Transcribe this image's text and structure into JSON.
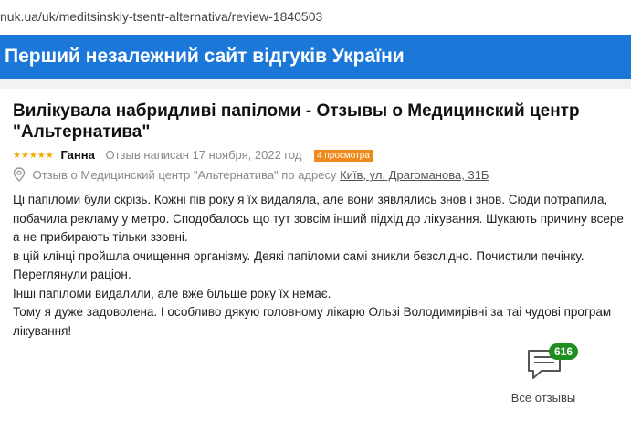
{
  "browser": {
    "url": "nuk.ua/uk/meditsinskiy-tsentr-alternativa/review-1840503"
  },
  "header": {
    "site_title": "Перший незалежний сайт відгуків України",
    "bg_color": "#1b78d8"
  },
  "review": {
    "title_line1": "Вилікувала набридливі папіломи - Отзывы о Медицинский центр",
    "title_line2": "\"Альтернатива\"",
    "stars": "★★★★★",
    "author": "Ганна",
    "date": "Отзыв написан 17 ноября, 2022 год",
    "views": "4 просмотра",
    "address_label": "Отзыв о Медицинский центр \"Альтернатива\" по адресу",
    "address_link": "Київ, ул. Драгоманова, 31Б",
    "body": [
      "Ці папіломи були скрізь. Кожні пів року я їх видаляла, але вони зявлялись знов і знов. Сюди потрапила,",
      "побачила рекламу у метро. Сподобалось що тут зовсім інший підхід до лікування. Шукають причину всере",
      "а не прибирають тільки ззовні.",
      "в цій клінці пройшла очищення організму. Деякі папіломи самі зникли безслідно. Почистили печінку.",
      "Переглянули раціон.",
      "Інші папіломи видалили, але вже більше року їх немає.",
      "Тому я дуже задоволена. І особливо дякую головному лікарю Ользі Володимирівні за таі чудові програм",
      "лікування!"
    ]
  },
  "all_reviews": {
    "count": "616",
    "label": "Все отзывы"
  }
}
